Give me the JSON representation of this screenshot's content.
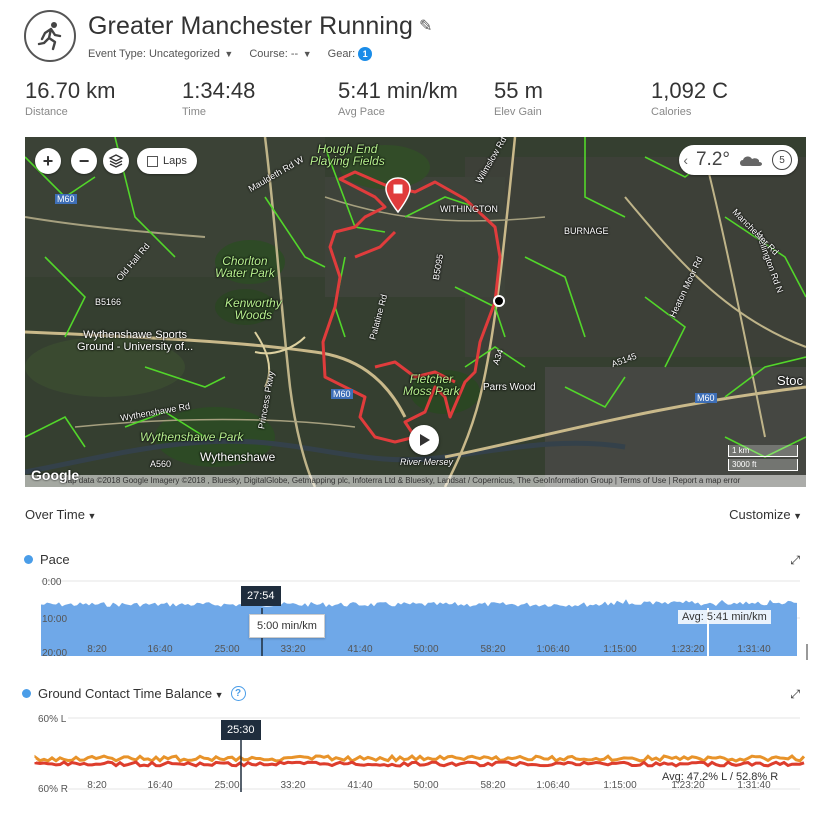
{
  "header": {
    "title": "Greater Manchester Running",
    "event_type_label": "Event Type: Uncategorized",
    "course_label": "Course: --",
    "gear_label": "Gear:",
    "gear_count": "1"
  },
  "stats": [
    {
      "value": "16.70 km",
      "label": "Distance"
    },
    {
      "value": "1:34:48",
      "label": "Time"
    },
    {
      "value": "5:41 min/km",
      "label": "Avg Pace"
    },
    {
      "value": "55 m",
      "label": "Elev Gain"
    },
    {
      "value": "1,092 C",
      "label": "Calories"
    }
  ],
  "map": {
    "laps_label": "Laps",
    "temperature": "7.2°",
    "timer_value": "5",
    "scale_km": "1 km",
    "scale_ft": "3000 ft",
    "google_logo": "Google",
    "attribution": "Map data ©2018 Google Imagery ©2018 , Bluesky, DigitalGlobe, Getmapping plc, Infoterra Ltd & Bluesky, Landsat / Copernicus, The GeoInformation Group  |  Terms of Use  |  Report a map error",
    "labels": {
      "hough_end": "Hough End\nPlaying Fields",
      "chorlton": "Chorlton\nWater Park",
      "kenworthy": "Kenworthy\nWoods",
      "wythenshawe_sports": "Wythenshawe Sports\nGround - University of...",
      "wythenshawe_park": "Wythenshawe Park",
      "wythenshawe": "Wythenshawe",
      "withington": "WITHINGTON",
      "burnage": "BURNAGE",
      "fletcher_moss": "Fletcher\nMoss Park",
      "parrs_wood": "Parrs Wood",
      "river_mersey": "River Mersey",
      "stockport": "Stoc",
      "m60_a": "M60",
      "m60_b": "M60",
      "m60_c": "M60",
      "a560": "A560",
      "a5145": "A5145",
      "a34": "A34",
      "b5166": "B5166",
      "b5095": "B5095",
      "palatine": "Palatine Rd",
      "princess": "Princess Pkwy",
      "wilmslow": "Wilmslow Rd",
      "wellington": "Wellington Rd N",
      "mauldeth": "Mauldeth Rd W",
      "heaton": "Heaton Moor Rd",
      "manchester_rd": "Manchester Rd",
      "wythenshawe_rd": "Wythenshawe Rd",
      "old_hall": "Old Hall Rd"
    }
  },
  "over_time": {
    "label": "Over Time",
    "customize_label": "Customize"
  },
  "pace_chart": {
    "label": "Pace",
    "y_ticks": [
      "0:00",
      "10:00",
      "20:00"
    ],
    "x_ticks": [
      "8:20",
      "16:40",
      "25:00",
      "33:20",
      "41:40",
      "50:00",
      "58:20",
      "1:06:40",
      "1:15:00",
      "1:23:20",
      "1:31:40"
    ],
    "marker_time": "27:54",
    "tooltip": "5:00 min/km",
    "avg_label": "Avg: 5:41 min/km"
  },
  "gct_chart": {
    "label": "Ground Contact Time Balance",
    "help": "?",
    "y_top": "60% L",
    "y_bottom": "60% R",
    "x_ticks": [
      "8:20",
      "16:40",
      "25:00",
      "33:20",
      "41:40",
      "50:00",
      "58:20",
      "1:06:40",
      "1:15:00",
      "1:23:20",
      "1:31:40"
    ],
    "marker_time": "25:30",
    "avg_label": "Avg: 47.2% L / 52.8% R"
  },
  "colors": {
    "route": "#e03c3c",
    "pace_fill": "#6fa8e8",
    "marker_bg": "#1f2d3d",
    "accent": "#1a8ce8",
    "gct_red": "#dd3d2d",
    "gct_orange": "#e8932a"
  }
}
